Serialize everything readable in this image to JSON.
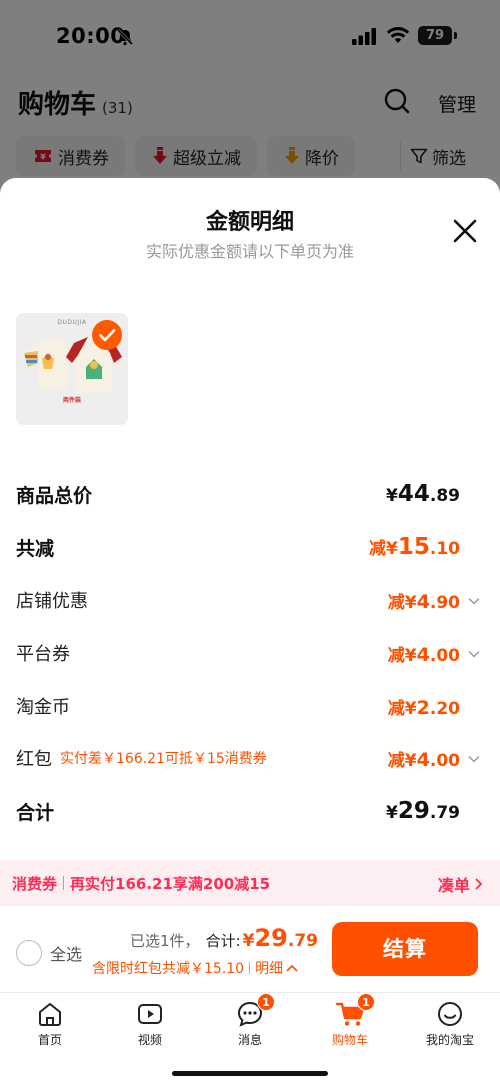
{
  "status_bar": {
    "time": "20:00",
    "battery": "79"
  },
  "cart_header": {
    "title": "购物车",
    "count": "(31)",
    "manage_label": "管理"
  },
  "filter_chips": [
    {
      "label": "消费券"
    },
    {
      "label": "超级立减"
    },
    {
      "label": "降价"
    }
  ],
  "filter_label": "筛选",
  "sheet": {
    "title": "金额明细",
    "subtitle": "实际优惠金额请以下单页为准"
  },
  "product": {
    "brand": "DUDUJIA",
    "tag": "两件装"
  },
  "rows": {
    "total_price": {
      "label": "商品总价",
      "currency": "¥",
      "int": "44",
      "dec": ".89"
    },
    "total_discount": {
      "label": "共减",
      "prefix": "减¥",
      "int": "15",
      "dec": ".10"
    },
    "store_discount": {
      "label": "店铺优惠",
      "prefix": "减¥",
      "int": "4",
      "dec": ".90"
    },
    "platform_coupon": {
      "label": "平台券",
      "prefix": "减¥",
      "int": "4",
      "dec": ".00"
    },
    "taojinbi": {
      "label": "淘金币",
      "prefix": "减¥",
      "int": "2",
      "dec": ".20"
    },
    "red_packet": {
      "label": "红包",
      "hint": "实付差￥166.21可抵￥15消费券",
      "prefix": "减¥",
      "int": "4",
      "dec": ".00"
    },
    "subtotal": {
      "label": "合计",
      "currency": "¥",
      "int": "29",
      "dec": ".79"
    }
  },
  "coupon_strip": {
    "tag": "消费券",
    "text": "再实付166.21享满200减15",
    "link": "凑单"
  },
  "checkout": {
    "select_all": "全选",
    "picked": "已选1件，",
    "sum_label": "合计:",
    "currency": "¥",
    "int": "29",
    "dec": ".79",
    "discount_text": "含限时红包共减￥15.10",
    "detail_link": "明细",
    "button": "结算"
  },
  "tabbar": [
    {
      "label": "首页"
    },
    {
      "label": "视频"
    },
    {
      "label": "消息",
      "badge": "1"
    },
    {
      "label": "购物车",
      "badge": "1"
    },
    {
      "label": "我的淘宝"
    }
  ],
  "colors": {
    "accent": "#ff5000",
    "coupon": "#ff2d55"
  }
}
